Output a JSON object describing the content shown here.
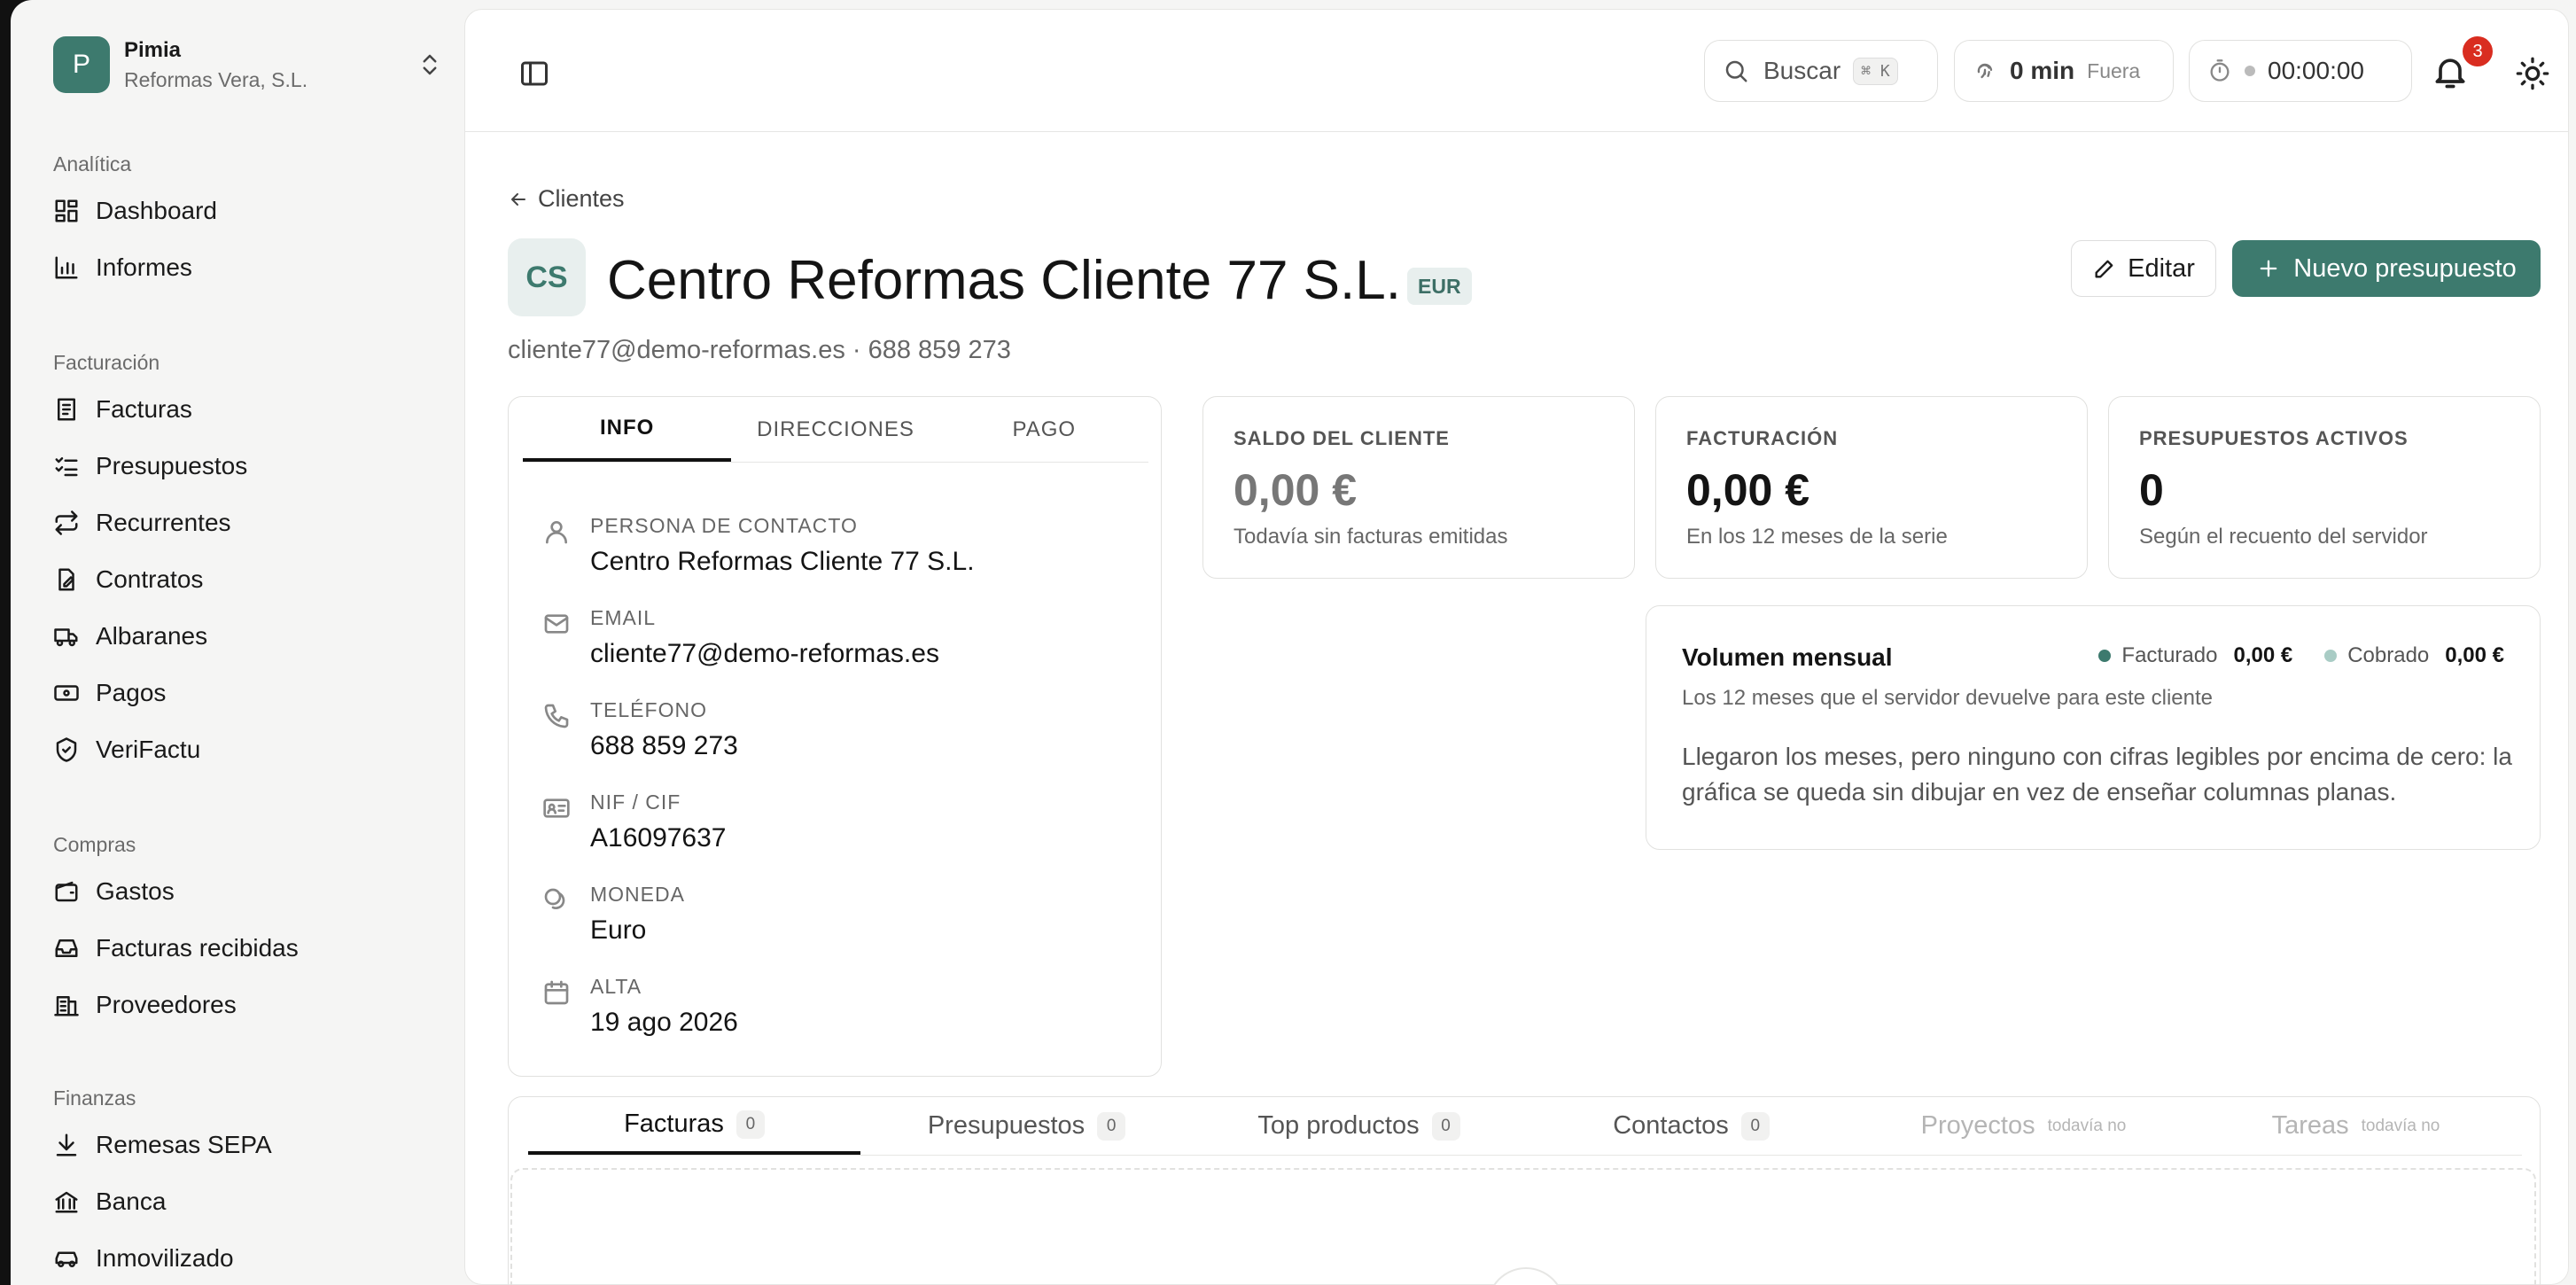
{
  "org": {
    "initial": "P",
    "name": "Pimia",
    "company": "Reformas Vera, S.L."
  },
  "sidebar": {
    "analytics": {
      "heading": "Analítica",
      "items": [
        {
          "label": "Dashboard",
          "icon": "dashboard-icon"
        },
        {
          "label": "Informes",
          "icon": "bar-chart-icon"
        }
      ]
    },
    "billing": {
      "heading": "Facturación",
      "items": [
        {
          "label": "Facturas",
          "icon": "invoice-icon"
        },
        {
          "label": "Presupuestos",
          "icon": "checklist-icon"
        },
        {
          "label": "Recurrentes",
          "icon": "repeat-icon"
        },
        {
          "label": "Contratos",
          "icon": "contract-icon"
        },
        {
          "label": "Albaranes",
          "icon": "truck-icon"
        },
        {
          "label": "Pagos",
          "icon": "banknote-icon"
        },
        {
          "label": "VeriFactu",
          "icon": "shield-check-icon"
        }
      ]
    },
    "purchases": {
      "heading": "Compras",
      "items": [
        {
          "label": "Gastos",
          "icon": "wallet-icon"
        },
        {
          "label": "Facturas recibidas",
          "icon": "inbox-icon"
        },
        {
          "label": "Proveedores",
          "icon": "building-icon"
        }
      ]
    },
    "finance": {
      "heading": "Finanzas",
      "items": [
        {
          "label": "Remesas SEPA",
          "icon": "download-icon"
        },
        {
          "label": "Banca",
          "icon": "bank-icon"
        },
        {
          "label": "Inmovilizado",
          "icon": "car-icon"
        }
      ]
    }
  },
  "topbar": {
    "search_label": "Buscar",
    "search_shortcut": "⌘ K",
    "presence_value": "0 min",
    "presence_status": "Fuera",
    "timer": "00:00:00",
    "notifications_count": "3"
  },
  "client": {
    "back_label": "Clientes",
    "initials": "CS",
    "name": "Centro Reformas Cliente 77 S.L.",
    "currency_tag": "EUR",
    "subtitle": "cliente77@demo-reformas.es · 688 859 273",
    "edit_label": "Editar",
    "new_quote_label": "Nuevo presupuesto"
  },
  "info": {
    "tabs": [
      "INFO",
      "DIRECCIONES",
      "PAGO"
    ],
    "fields": [
      {
        "label": "PERSONA DE CONTACTO",
        "value": "Centro Reformas Cliente 77 S.L."
      },
      {
        "label": "EMAIL",
        "value": "cliente77@demo-reformas.es"
      },
      {
        "label": "TELÉFONO",
        "value": "688 859 273"
      },
      {
        "label": "NIF / CIF",
        "value": "A16097637"
      },
      {
        "label": "MONEDA",
        "value": "Euro"
      },
      {
        "label": "ALTA",
        "value": "19 ago 2026"
      }
    ]
  },
  "stats": [
    {
      "label": "SALDO DEL CLIENTE",
      "value": "0,00 €",
      "note": "Todavía sin facturas emitidas"
    },
    {
      "label": "FACTURACIÓN",
      "value": "0,00 €",
      "note": "En los 12 meses de la serie"
    },
    {
      "label": "PRESUPUESTOS ACTIVOS",
      "value": "0",
      "note": "Según el recuento del servidor"
    }
  ],
  "volume": {
    "title": "Volumen mensual",
    "subtitle": "Los 12 meses que el servidor devuelve para este cliente",
    "legend": [
      {
        "label": "Facturado",
        "value": "0,00 €",
        "color": "#3d7a6e"
      },
      {
        "label": "Cobrado",
        "value": "0,00 €",
        "color": "#a9ccc5"
      }
    ],
    "message": "Llegaron los meses, pero ninguno con cifras legibles por encima de cero: la gráfica se queda sin dibujar en vez de enseñar columnas planas."
  },
  "bottom_tabs": [
    {
      "label": "Facturas",
      "count": "0"
    },
    {
      "label": "Presupuestos",
      "count": "0"
    },
    {
      "label": "Top productos",
      "count": "0"
    },
    {
      "label": "Contactos",
      "count": "0"
    },
    {
      "label": "Proyectos",
      "note": "todavía no"
    },
    {
      "label": "Tareas",
      "note": "todavía no"
    }
  ]
}
